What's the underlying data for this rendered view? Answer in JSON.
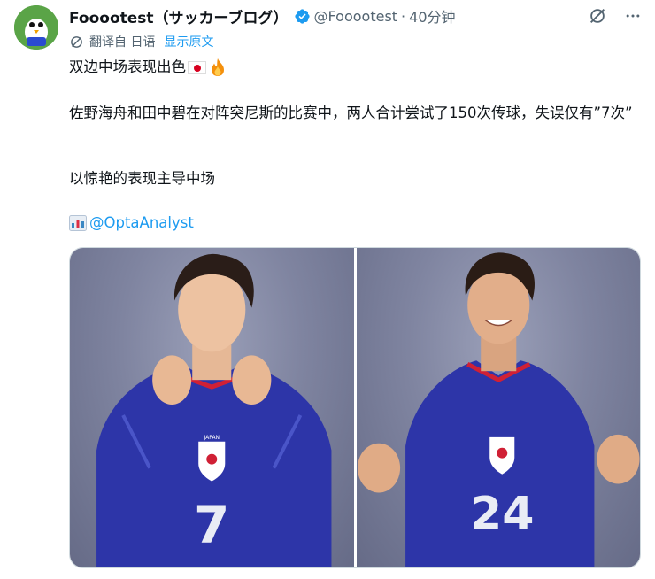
{
  "author": {
    "name": "Fooootest（サッカーブログ）",
    "handle": "@Fooootest",
    "separator": "·",
    "time": "40分钟"
  },
  "icons": {
    "verified": "verified-badge-icon",
    "grok": "grok-icon",
    "more": "more-icon",
    "translate": "globe-icon"
  },
  "translation": {
    "label": "翻译自 日语",
    "show_original": "显示原文"
  },
  "post": {
    "line1": "双边中场表现出色",
    "line2": "佐野海舟和田中碧在对阵突尼斯的比赛中，两人合计尝试了150次传球，失误仅有”7次”",
    "line3": "以惊艳的表现主导中场",
    "mention": "@OptaAnalyst"
  },
  "media": {
    "left_number": "7",
    "right_number": "24",
    "badge_text": "JAPAN"
  },
  "colors": {
    "link": "#1d9bf0",
    "muted": "#536471",
    "text": "#0f1419",
    "jersey": "#2d35a8"
  }
}
